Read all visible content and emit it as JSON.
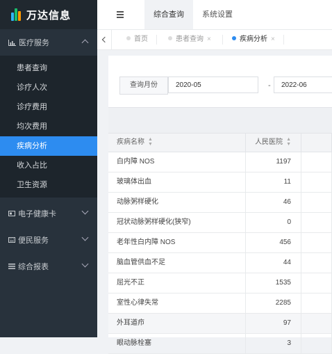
{
  "app": {
    "title": "万达信息"
  },
  "sidebar": {
    "groups": [
      {
        "label": "医疗服务",
        "icon": "bar-chart-icon",
        "expanded": true,
        "items": [
          {
            "label": "患者查询"
          },
          {
            "label": "诊疗人次"
          },
          {
            "label": "诊疗费用"
          },
          {
            "label": "均次费用"
          },
          {
            "label": "疾病分析",
            "active": true
          },
          {
            "label": "收入占比"
          },
          {
            "label": "卫生资源"
          }
        ]
      },
      {
        "label": "电子健康卡",
        "icon": "card-icon",
        "expanded": false
      },
      {
        "label": "便民服务",
        "icon": "keyboard-icon",
        "expanded": false
      },
      {
        "label": "综合报表",
        "icon": "list-icon",
        "expanded": false
      }
    ]
  },
  "header": {
    "tabs": [
      {
        "label": "综合查询",
        "active": true
      },
      {
        "label": "系统设置",
        "active": false
      }
    ]
  },
  "tags": {
    "items": [
      {
        "label": "首页",
        "closable": false,
        "active": false
      },
      {
        "label": "患者查询",
        "closable": true,
        "active": false
      },
      {
        "label": "疾病分析",
        "closable": true,
        "active": true
      }
    ],
    "close_glyph": "×"
  },
  "filter": {
    "label": "查询月份",
    "start": "2020-05",
    "separator": "-",
    "end": "2022-06"
  },
  "table": {
    "columns": [
      {
        "label": "疾病名称",
        "sortable": true
      },
      {
        "label": "人民医院",
        "sortable": true
      }
    ],
    "rows": [
      {
        "name": "白内障 NOS",
        "value": "1197"
      },
      {
        "name": "玻璃体出血",
        "value": "11"
      },
      {
        "name": "动脉粥样硬化",
        "value": "46"
      },
      {
        "name": "冠状动脉粥样硬化(狭窄)",
        "value": "0"
      },
      {
        "name": "老年性白内障 NOS",
        "value": "456"
      },
      {
        "name": "脑血管供血不足",
        "value": "44"
      },
      {
        "name": "屈光不正",
        "value": "1535"
      },
      {
        "name": "室性心律失常",
        "value": "2285"
      },
      {
        "name": "外耳道疖",
        "value": "97",
        "highlighted": true
      },
      {
        "name": "眼动脉栓塞",
        "value": "3"
      }
    ]
  },
  "colors": {
    "sidebar_bg": "#28323c",
    "accent": "#2d8cf0"
  }
}
